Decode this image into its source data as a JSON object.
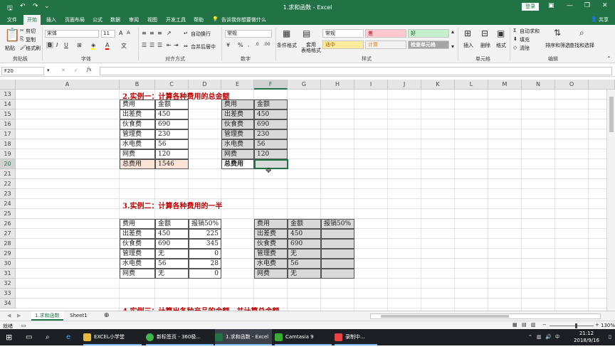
{
  "window": {
    "title": "1.求和函数 - Excel",
    "login": "登录"
  },
  "tabs": [
    "文件",
    "开始",
    "插入",
    "页面布局",
    "公式",
    "数据",
    "审阅",
    "视图",
    "开发工具",
    "帮助"
  ],
  "tell_me": "告诉我你想要做什么",
  "share": "共享",
  "ribbon": {
    "cut": "剪切",
    "copy": "复制",
    "format_painter": "格式刷",
    "paste": "粘贴",
    "font_name": "宋体",
    "font_size": "11",
    "wrap": "自动换行",
    "merge": "合并后居中",
    "number_format": "常规",
    "cond_format": "条件格式",
    "table_format": "套用\n表格格式",
    "styles": {
      "normal": "常规",
      "bad": "差",
      "good": "好",
      "neutral": "适中",
      "calc": "计算",
      "check": "检查单元格"
    },
    "insert": "插入",
    "delete": "删除",
    "format": "格式",
    "autosum": "自动求和",
    "fill": "填充",
    "clear": "清除",
    "sort": "排序和筛选",
    "find": "查找和选择",
    "groups": [
      "剪贴板",
      "字体",
      "对齐方式",
      "数字",
      "样式",
      "单元格",
      "编辑"
    ]
  },
  "name_box": "F20",
  "columns": [
    "A",
    "B",
    "C",
    "D",
    "E",
    "F",
    "G",
    "H",
    "I",
    "J",
    "K",
    "L",
    "M",
    "N",
    "O"
  ],
  "rows": [
    "13",
    "14",
    "15",
    "16",
    "17",
    "18",
    "19",
    "20",
    "21",
    "22",
    "23",
    "24",
    "25",
    "26",
    "27",
    "28",
    "29",
    "30",
    "31",
    "32",
    "33",
    "34"
  ],
  "example1": {
    "title": "2.实例一：计算各种费用的总金额",
    "headers": [
      "费用",
      "金额"
    ],
    "items": [
      [
        "出差费",
        "450"
      ],
      [
        "伙食费",
        "690"
      ],
      [
        "管理费",
        "230"
      ],
      [
        "水电费",
        "56"
      ],
      [
        "网费",
        "120"
      ]
    ],
    "total_label": "总费用",
    "total_value": "1546"
  },
  "example2": {
    "title": "3.实例二：计算各种费用的一半",
    "headers": [
      "费用",
      "金额",
      "报销50%"
    ],
    "items": [
      [
        "出差费",
        "450",
        "225"
      ],
      [
        "伙食费",
        "690",
        "345"
      ],
      [
        "管理费",
        "无",
        "0"
      ],
      [
        "水电费",
        "56",
        "28"
      ],
      [
        "网费",
        "无",
        "0"
      ]
    ],
    "right_amounts": [
      "450",
      "690",
      "无",
      "56",
      "无"
    ]
  },
  "example3_partial": "4.实例三：计算出各种产品的金额，并计算总金额",
  "sheets": [
    "1.求和函数",
    "Sheet1"
  ],
  "status": {
    "ready": "就绪",
    "zoom": "130%"
  },
  "taskbar": {
    "items": [
      "EXCEL小学堂",
      "新标签页 - 360极...",
      "1.求和函数 - Excel",
      "Camtasia 9",
      "录制中..."
    ],
    "time": "21:12",
    "date": "2018/9/16"
  }
}
